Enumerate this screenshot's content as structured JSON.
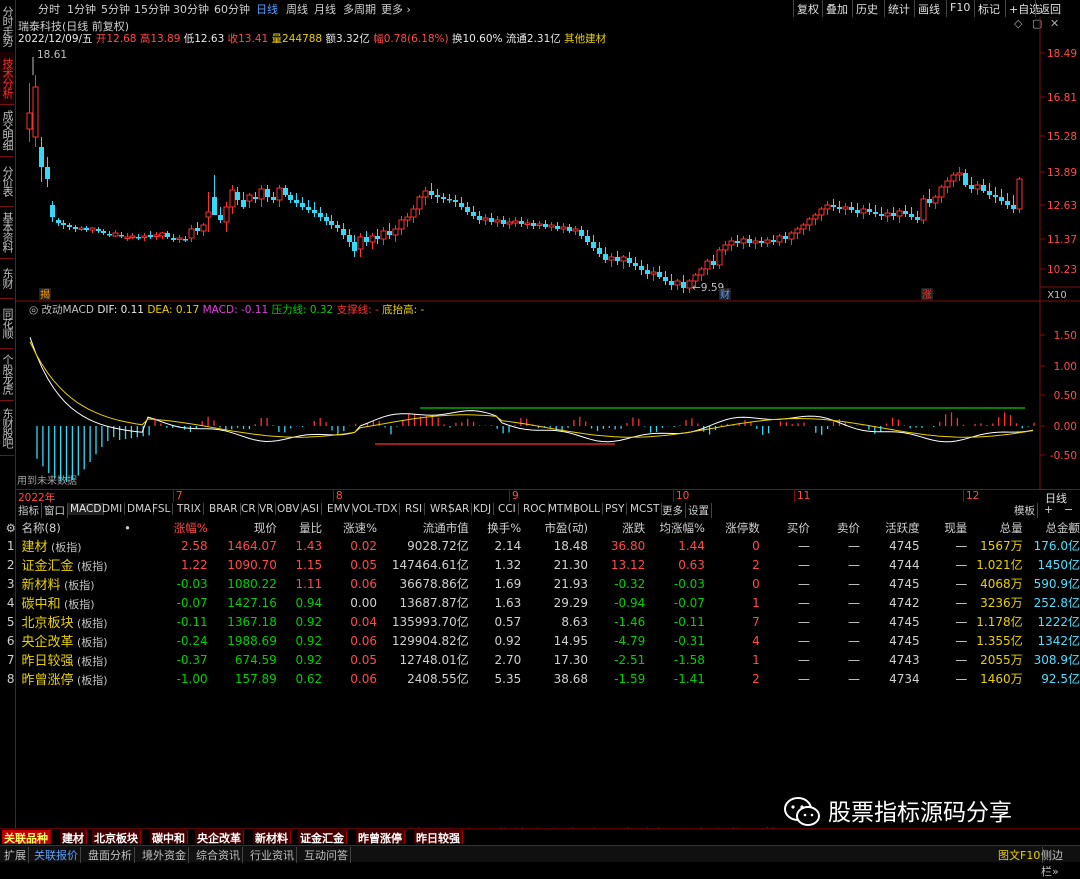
{
  "left_tabs": [
    {
      "label": "分时走势",
      "active": false
    },
    {
      "label": "技术分析",
      "active": true
    },
    {
      "label": "成交明细",
      "active": false
    },
    {
      "label": "分价表",
      "active": false
    },
    {
      "label": "基本资料",
      "active": false
    },
    {
      "label": "东财10",
      "active": false
    },
    {
      "label": "同花顺10",
      "active": false
    },
    {
      "label": "个股龙虎",
      "active": false
    },
    {
      "label": "东财股吧",
      "active": false
    }
  ],
  "periods": [
    "分时",
    "1分钟",
    "5分钟",
    "15分钟",
    "30分钟",
    "60分钟",
    "日线",
    "周线",
    "月线",
    "多周期",
    "更多 ›"
  ],
  "active_period": "日线",
  "toolbar_buttons": [
    "复权",
    "叠加",
    "历史",
    "统计",
    "画线",
    "F10",
    "标记",
    "+自选",
    "返回"
  ],
  "stock": {
    "title": "瑞泰科技(日线 前复权)",
    "date": "2022/12/09/五",
    "open_label": "开",
    "open": "12.68",
    "high_label": "高",
    "high": "13.89",
    "low_label": "低",
    "low": "12.63",
    "close_label": "收",
    "close": "13.41",
    "vol_label": "量",
    "vol": "244788",
    "amt_label": "额",
    "amt": "3.32亿",
    "chg_label": "幅",
    "chg": "0.78(6.18%)",
    "turn_label": "换",
    "turn": "10.60%",
    "float_label": "流通",
    "float_val": "2.31亿",
    "sector": "其他建材"
  },
  "price_axis": [
    "18.49",
    "16.81",
    "15.28",
    "13.89",
    "12.63",
    "11.37",
    "10.23"
  ],
  "price_marks": {
    "high": "18.61",
    "low": "9.59",
    "x10": "X10"
  },
  "price_flags": [
    "揭",
    "财",
    "涨"
  ],
  "macd": {
    "name": "改动MACD",
    "dif_label": "DIF:",
    "dif": "0.11",
    "dea_label": "DEA:",
    "dea": "0.17",
    "macd_label": "MACD:",
    "macd": "-0.11",
    "press_label": "压力线:",
    "press": "0.32",
    "support_label": "支撑线:",
    "support": "-",
    "bottom_label": "底抬高:",
    "bottom": "-",
    "axis": [
      "1.50",
      "1.00",
      "0.50",
      "0.00",
      "-0.50"
    ],
    "note": "用到未来数据"
  },
  "date_axis": {
    "year": "2022年",
    "months": [
      "7",
      "8",
      "9",
      "10",
      "11",
      "12"
    ],
    "right_label": "日线"
  },
  "indicator_tabs": [
    "指标",
    "窗口",
    "MACD",
    "DMI",
    "DMA",
    "FSL",
    "TRIX",
    "BRAR",
    "CR",
    "VR",
    "OBV",
    "ASI",
    "EMV",
    "VOL-TDX",
    "RSI",
    "WR",
    "SAR",
    "KDJ",
    "CCI",
    "ROC",
    "MTM",
    "BOLL",
    "PSY",
    "MCST",
    "更多",
    "设置"
  ],
  "template_label": "模板",
  "table": {
    "headers": [
      "名称(8)",
      "•",
      "涨幅%",
      "现价",
      "量比",
      "涨速%",
      "流通市值",
      "换手%",
      "市盈(动)",
      "涨跌",
      "均涨幅%",
      "涨停数",
      "买价",
      "卖价",
      "活跃度",
      "现量",
      "总量",
      "总金额"
    ],
    "rows": [
      {
        "idx": "1",
        "name": "建材",
        "tag": "(板指)",
        "pct": "2.58",
        "price": "1464.07",
        "vr": "1.43",
        "spd": "0.02",
        "mcap": "9028.72亿",
        "turn": "2.14",
        "pe": "18.48",
        "chg": "36.80",
        "avg": "1.44",
        "lim": "0",
        "bid": "—",
        "ask": "—",
        "act": "4745",
        "cur": "—",
        "vol": "1567万",
        "amt": "176.0亿",
        "dir": "up"
      },
      {
        "idx": "2",
        "name": "证金汇金",
        "tag": "(板指)",
        "pct": "1.22",
        "price": "1090.70",
        "vr": "1.15",
        "spd": "0.05",
        "mcap": "147464.61亿",
        "turn": "1.32",
        "pe": "21.30",
        "chg": "13.12",
        "avg": "0.63",
        "lim": "2",
        "bid": "—",
        "ask": "—",
        "act": "4744",
        "cur": "—",
        "vol": "1.021亿",
        "amt": "1450亿",
        "dir": "up"
      },
      {
        "idx": "3",
        "name": "新材料",
        "tag": "(板指)",
        "pct": "-0.03",
        "price": "1080.22",
        "vr": "1.11",
        "spd": "0.06",
        "mcap": "36678.86亿",
        "turn": "1.69",
        "pe": "21.93",
        "chg": "-0.32",
        "avg": "-0.03",
        "lim": "0",
        "bid": "—",
        "ask": "—",
        "act": "4745",
        "cur": "—",
        "vol": "4068万",
        "amt": "590.9亿",
        "dir": "down"
      },
      {
        "idx": "4",
        "name": "碳中和",
        "tag": "(板指)",
        "pct": "-0.07",
        "price": "1427.16",
        "vr": "0.94",
        "spd": "0.00",
        "mcap": "13687.87亿",
        "turn": "1.63",
        "pe": "29.29",
        "chg": "-0.94",
        "avg": "-0.07",
        "lim": "1",
        "bid": "—",
        "ask": "—",
        "act": "4742",
        "cur": "—",
        "vol": "3236万",
        "amt": "252.8亿",
        "dir": "down"
      },
      {
        "idx": "5",
        "name": "北京板块",
        "tag": "(板指)",
        "pct": "-0.11",
        "price": "1367.18",
        "vr": "0.92",
        "spd": "0.04",
        "mcap": "135993.70亿",
        "turn": "0.57",
        "pe": "8.63",
        "chg": "-1.46",
        "avg": "-0.11",
        "lim": "7",
        "bid": "—",
        "ask": "—",
        "act": "4745",
        "cur": "—",
        "vol": "1.178亿",
        "amt": "1222亿",
        "dir": "down"
      },
      {
        "idx": "6",
        "name": "央企改革",
        "tag": "(板指)",
        "pct": "-0.24",
        "price": "1988.69",
        "vr": "0.92",
        "spd": "0.06",
        "mcap": "129904.82亿",
        "turn": "0.92",
        "pe": "14.95",
        "chg": "-4.79",
        "avg": "-0.31",
        "lim": "4",
        "bid": "—",
        "ask": "—",
        "act": "4745",
        "cur": "—",
        "vol": "1.355亿",
        "amt": "1342亿",
        "dir": "down"
      },
      {
        "idx": "7",
        "name": "昨日较强",
        "tag": "(板指)",
        "pct": "-0.37",
        "price": "674.59",
        "vr": "0.92",
        "spd": "0.05",
        "mcap": "12748.01亿",
        "turn": "2.70",
        "pe": "17.30",
        "chg": "-2.51",
        "avg": "-1.58",
        "lim": "1",
        "bid": "—",
        "ask": "—",
        "act": "4743",
        "cur": "—",
        "vol": "2055万",
        "amt": "308.9亿",
        "dir": "down"
      },
      {
        "idx": "8",
        "name": "昨曾涨停",
        "tag": "(板指)",
        "pct": "-1.00",
        "price": "157.89",
        "vr": "0.62",
        "spd": "0.06",
        "mcap": "2408.55亿",
        "turn": "5.35",
        "pe": "38.68",
        "chg": "-1.59",
        "avg": "-1.41",
        "lim": "2",
        "bid": "—",
        "ask": "—",
        "act": "4734",
        "cur": "—",
        "vol": "1460万",
        "amt": "92.5亿",
        "dir": "down"
      }
    ]
  },
  "bottom_tabs": [
    "关联品种",
    "建材",
    "北京板块",
    "碳中和",
    "央企改革",
    "新材料",
    "证金汇金",
    "昨曾涨停",
    "昨日较强"
  ],
  "bottom_links": [
    "扩展",
    "关联报价",
    "盘面分析",
    "境外资金",
    "综合资讯",
    "行业资讯",
    "互动问答"
  ],
  "bottom_right": [
    "图文F10",
    "侧边栏»"
  ],
  "marquee": "唐诗宋歌-周华健/任贤齐/李心洁/窦智孔/李晓琪/万芳/",
  "watermark": "股票指标源码分享",
  "colors": {
    "up": "#ff4a4a",
    "down": "#00d000",
    "yellow": "#e8d000",
    "cyan": "#4fe0ff",
    "bg": "#000000",
    "grid": "#7a1010"
  }
}
